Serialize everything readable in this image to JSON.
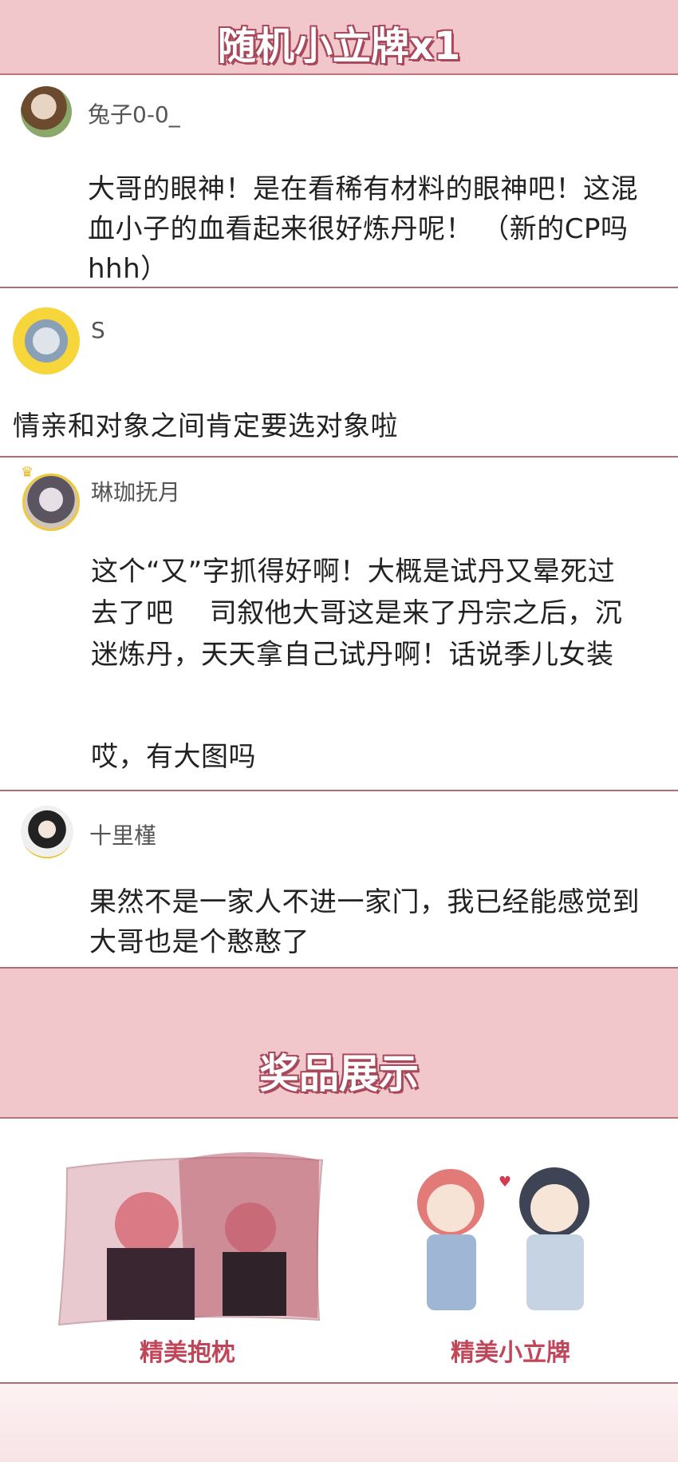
{
  "header": {
    "title": "随机小立牌x1"
  },
  "comments": [
    {
      "username": "兔子0-0_",
      "text_lines": [
        "大哥的眼神！是在看稀有材料的眼神吧！这混",
        "血小子的血看起来很好炼丹呢！ （新的CP吗",
        "hhh）"
      ]
    },
    {
      "username": "S",
      "text_lines": [
        "情亲和对象之间肯定要选对象啦"
      ]
    },
    {
      "username": "琳珈抚月",
      "text_lines": [
        "这个“又”字抓得好啊！大概是试丹又晕死过",
        "去了吧    司叙他大哥这是来了丹宗之后，沉",
        "迷炼丹，天天拿自己试丹啊！话说季儿女装",
        "",
        "哎，有大图吗"
      ]
    },
    {
      "username": "十里槿",
      "text_lines": [
        "果然不是一家人不进一家门，我已经能感觉到",
        "大哥也是个憨憨了"
      ]
    }
  ],
  "prizes_section": {
    "title": "奖品展示"
  },
  "prizes": [
    {
      "label": "精美抱枕"
    },
    {
      "label": "精美小立牌"
    }
  ],
  "colors": {
    "band": "#f1c7cc",
    "accent": "#c0465a",
    "divider": "#b06d76"
  }
}
